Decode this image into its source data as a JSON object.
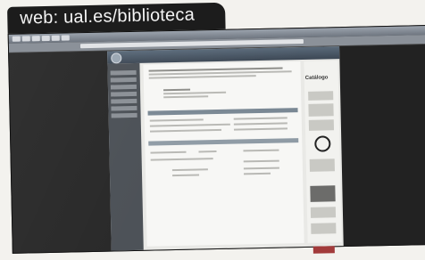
{
  "caption": {
    "text": "web: ual.es/biblioteca"
  },
  "site": {
    "sidebar_label": "Catálogo"
  }
}
